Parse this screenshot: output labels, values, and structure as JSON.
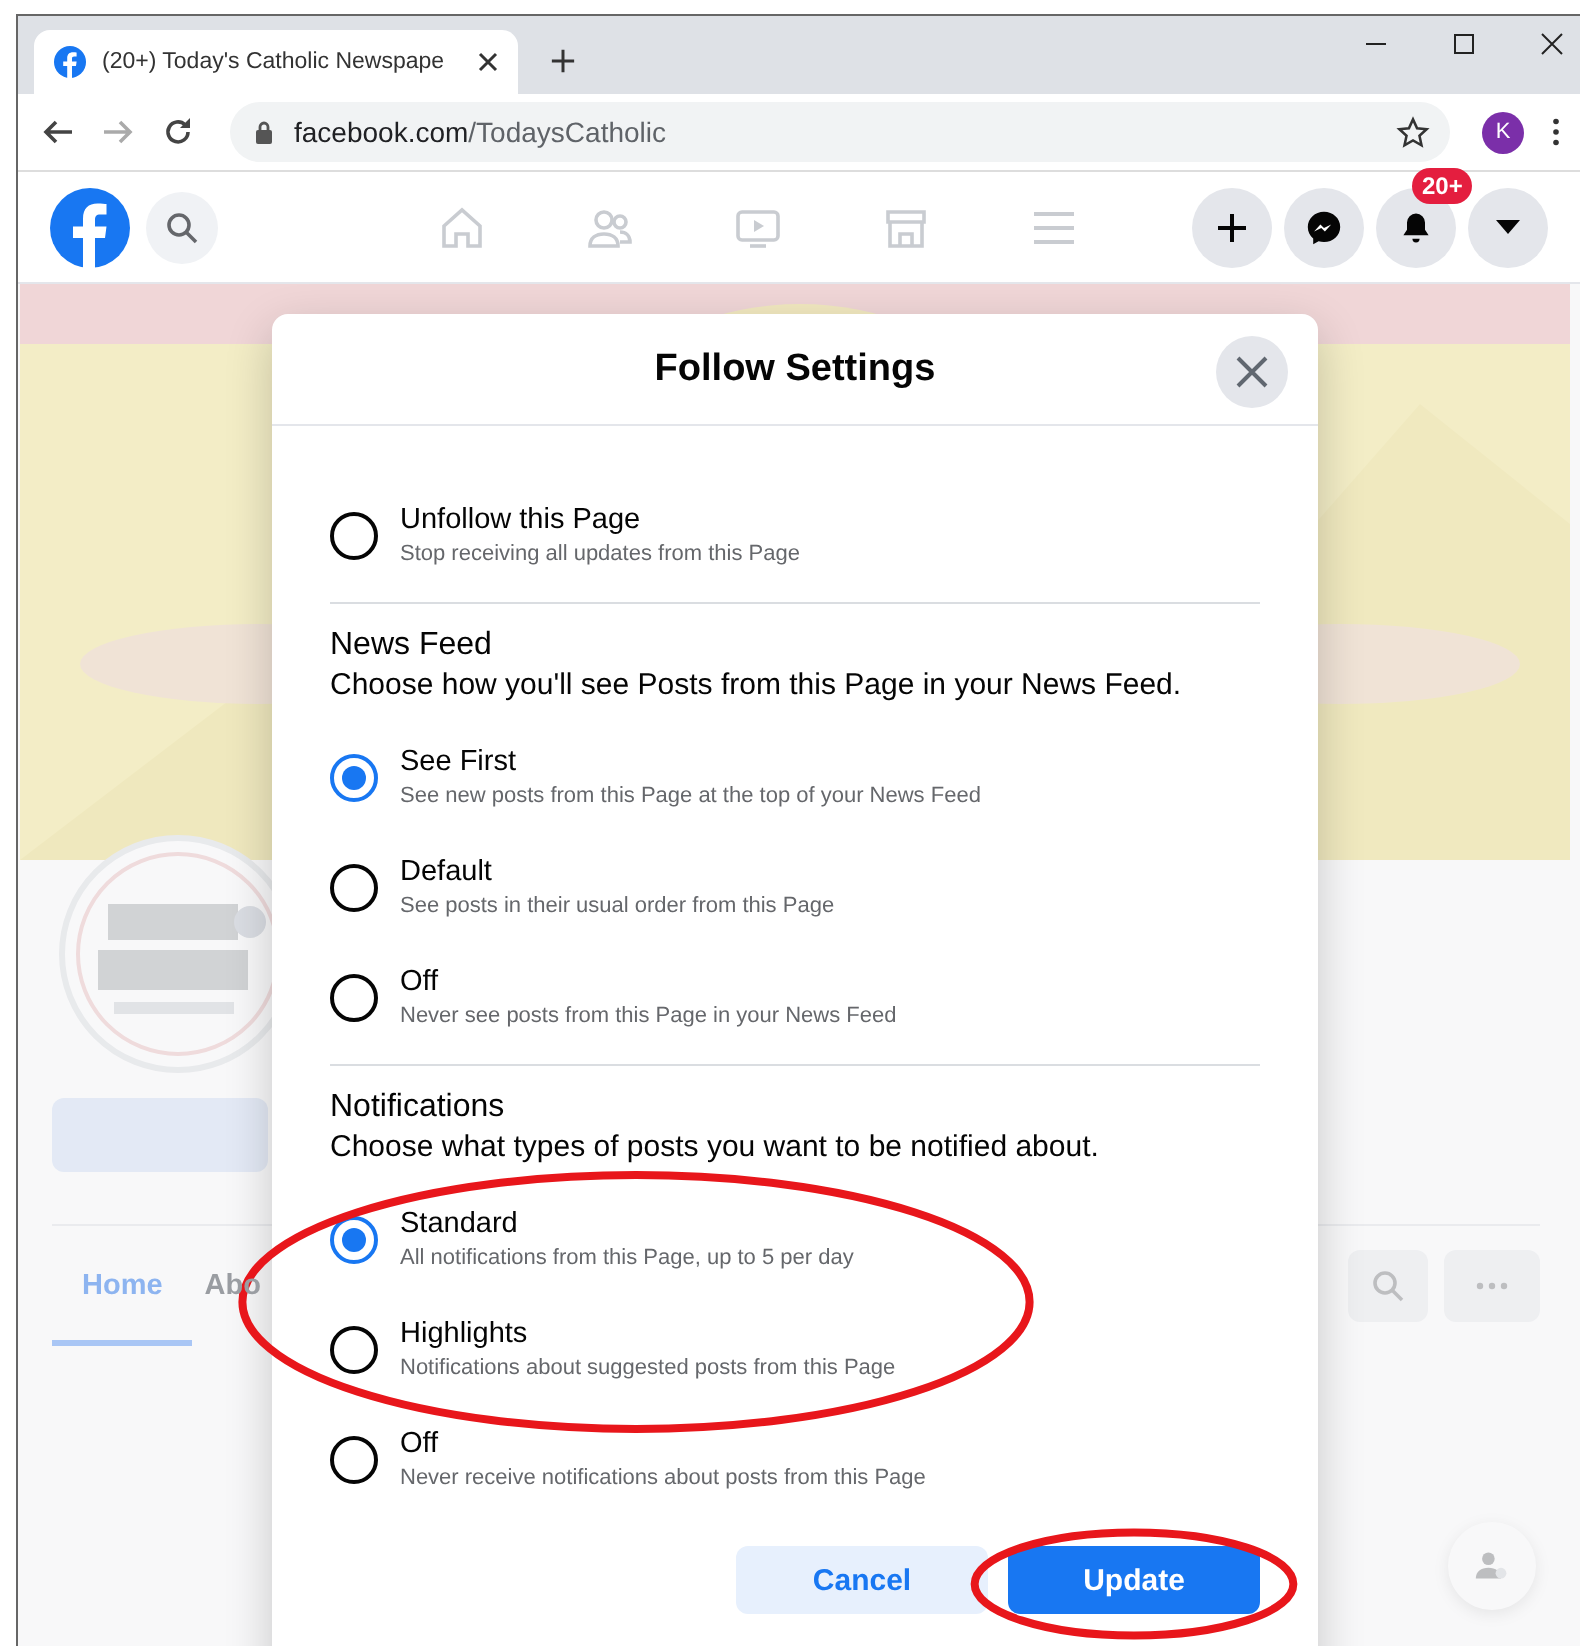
{
  "browser": {
    "tab_title": "(20+) Today's Catholic Newspape",
    "url_domain": "facebook.com",
    "url_path": "/TodaysCatholic",
    "profile_initial": "K"
  },
  "facebook_header": {
    "notification_badge": "20+"
  },
  "page": {
    "tabs": [
      {
        "label": "Home",
        "selected": true
      },
      {
        "label": "Abo",
        "selected": false
      }
    ]
  },
  "dialog": {
    "title": "Follow Settings",
    "sections": [
      {
        "options": [
          {
            "label": "Unfollow this Page",
            "description": "Stop receiving all updates from this Page",
            "selected": false
          }
        ]
      },
      {
        "heading": "News Feed",
        "description": "Choose how you'll see Posts from this Page in your News Feed.",
        "options": [
          {
            "label": "See First",
            "description": "See new posts from this Page at the top of your News Feed",
            "selected": true
          },
          {
            "label": "Default",
            "description": "See posts in their usual order from this Page",
            "selected": false
          },
          {
            "label": "Off",
            "description": "Never see posts from this Page in your News Feed",
            "selected": false
          }
        ]
      },
      {
        "heading": "Notifications",
        "description": "Choose what types of posts you want to be notified about.",
        "options": [
          {
            "label": "Standard",
            "description": "All notifications from this Page, up to 5 per day",
            "selected": true
          },
          {
            "label": "Highlights",
            "description": "Notifications about suggested posts from this Page",
            "selected": false
          },
          {
            "label": "Off",
            "description": "Never receive notifications about posts from this Page",
            "selected": false
          }
        ]
      }
    ],
    "buttons": [
      {
        "label": "Cancel",
        "kind": "secondary"
      },
      {
        "label": "Update",
        "kind": "primary"
      }
    ]
  },
  "annotations": [
    {
      "kind": "ellipse",
      "color": "#e8161b"
    },
    {
      "kind": "ellipse",
      "color": "#e8161b"
    }
  ]
}
